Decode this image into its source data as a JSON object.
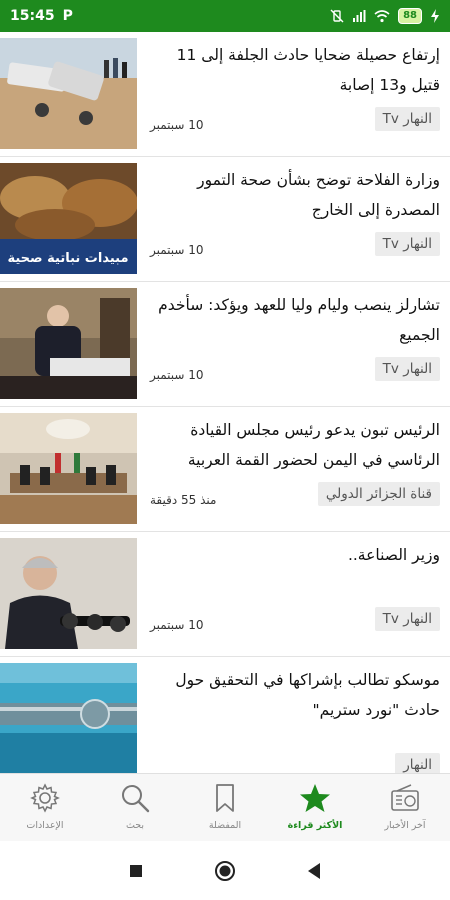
{
  "status": {
    "time": "15:45",
    "carrier_icon": "P",
    "battery": "88"
  },
  "articles": [
    {
      "headline": "إرتفاع حصيلة ضحايا حادث الجلفة إلى 11 قتيل و13 إصابة",
      "source": "النهار Tv",
      "date": "10 سبتمبر"
    },
    {
      "headline": "وزارة الفلاحة توضح بشأن صحة التمور المصدرة إلى الخارج",
      "source": "النهار Tv",
      "date": "10 سبتمبر",
      "image_caption": "مبيدات نباتية صحية"
    },
    {
      "headline": "تشارلز ينصب وليام وليا للعهد ويؤكد: سأخدم الجميع",
      "source": "النهار Tv",
      "date": "10 سبتمبر"
    },
    {
      "headline": "الرئيس تبون يدعو رئيس مجلس القيادة الرئاسي في اليمن لحضور القمة العربية",
      "source": "قناة الجزائر الدولي",
      "date": "منذ 55 دقيقة"
    },
    {
      "headline": "وزير الصناعة..",
      "source": "النهار Tv",
      "date": "10 سبتمبر"
    },
    {
      "headline": "موسكو تطالب بإشراكها في التحقيق حول حادث \"نورد ستريم\"",
      "source": "النهار",
      "date": ""
    }
  ],
  "nav": [
    {
      "label": "الإعدادات",
      "icon": "gear-icon"
    },
    {
      "label": "بحث",
      "icon": "search-icon"
    },
    {
      "label": "المفضلة",
      "icon": "bookmark-icon"
    },
    {
      "label": "الأكثر قراءة",
      "icon": "star-icon"
    },
    {
      "label": "آخر الأخبار",
      "icon": "radio-icon"
    }
  ],
  "colors": {
    "accent": "#1e8a1e",
    "nav_inactive": "#888888"
  }
}
